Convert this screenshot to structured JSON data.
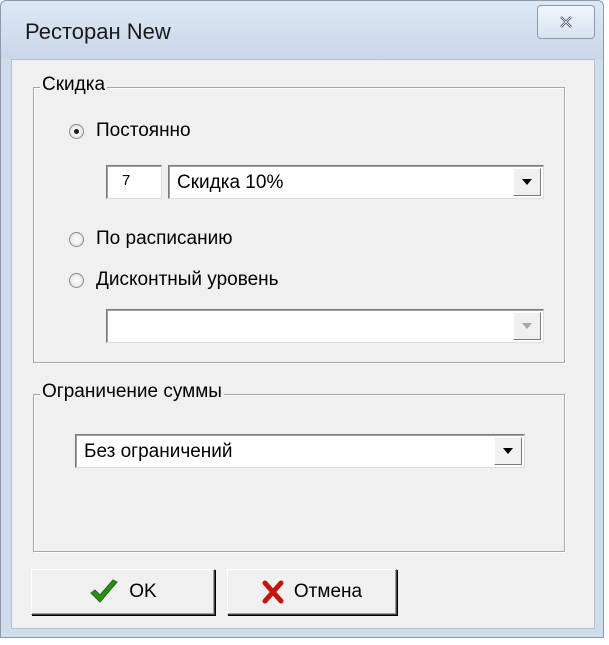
{
  "window": {
    "title": "Ресторан New"
  },
  "discount_group": {
    "label": "Скидка",
    "option_constant": "Постоянно",
    "code": "7",
    "discount_select": "Скидка 10%",
    "option_schedule": "По расписанию",
    "option_discount_level": "Дисконтный уровень",
    "level_select": "",
    "selected": "constant"
  },
  "limit_group": {
    "label": "Ограничение суммы",
    "limit_select": "Без ограничений"
  },
  "buttons": {
    "ok": "OK",
    "cancel": "Отмена"
  },
  "icons": {
    "close": "close-icon",
    "ok": "checkmark-icon",
    "cancel": "cross-icon",
    "dropdown": "dropdown-arrow-icon"
  },
  "colors": {
    "ok_icon": "#2e8b17",
    "cancel_icon": "#c0160f"
  }
}
